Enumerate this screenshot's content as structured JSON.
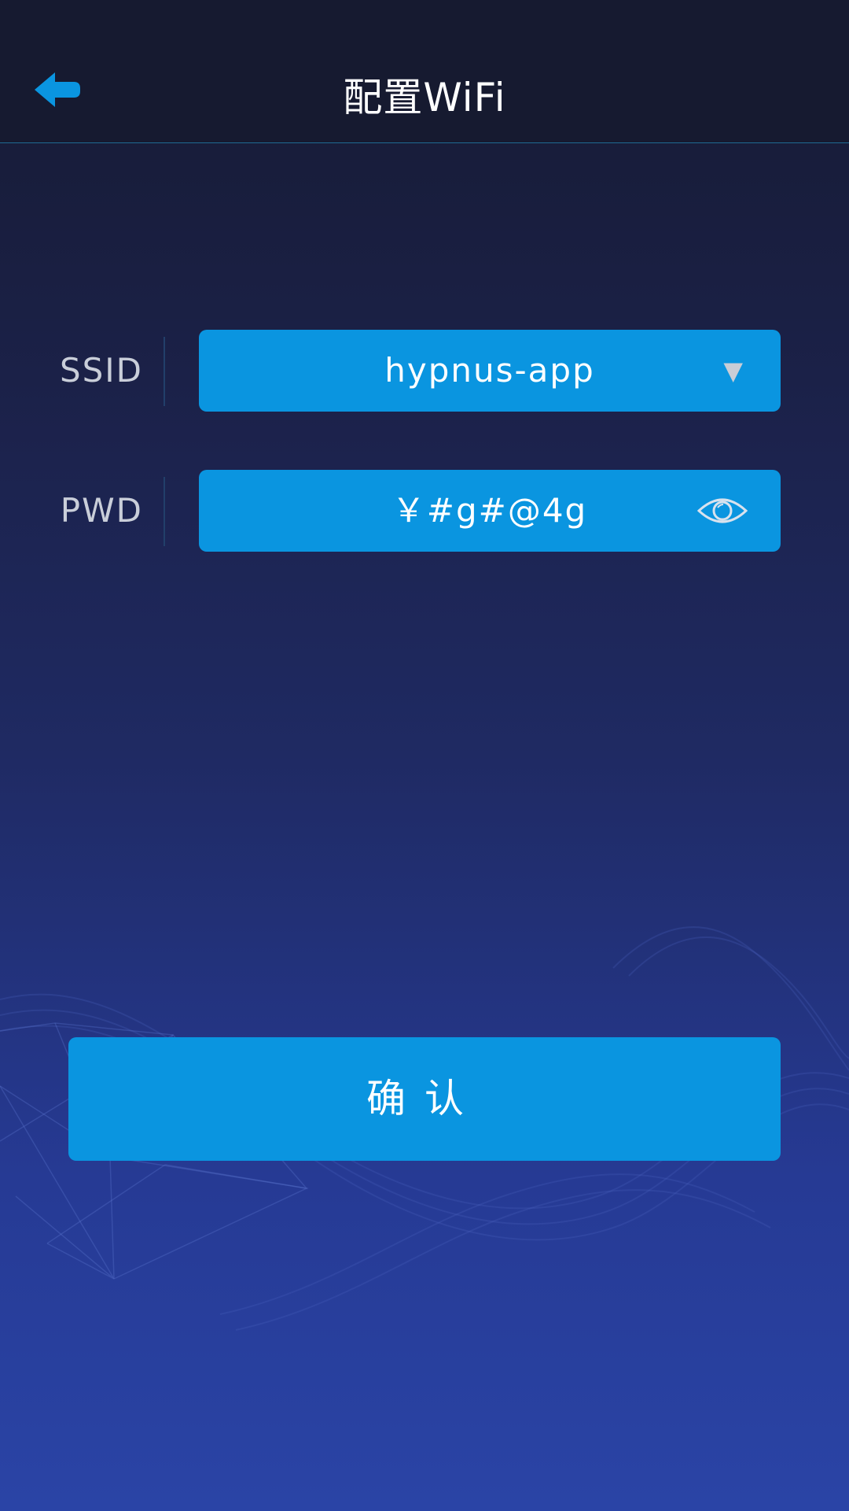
{
  "header": {
    "title": "配置WiFi",
    "back_icon": "back-arrow-icon"
  },
  "ssid": {
    "label": "SSID",
    "value": "hypnus-app",
    "dropdown_icon": "triangle-down-icon"
  },
  "password": {
    "label": "PWD",
    "value": "￥#g#@4g",
    "toggle_icon": "eye-icon"
  },
  "confirm": {
    "label": "确认"
  },
  "colors": {
    "accent": "#0a95e0",
    "header_bg": "#161a30",
    "label_text": "#c9ced9"
  }
}
